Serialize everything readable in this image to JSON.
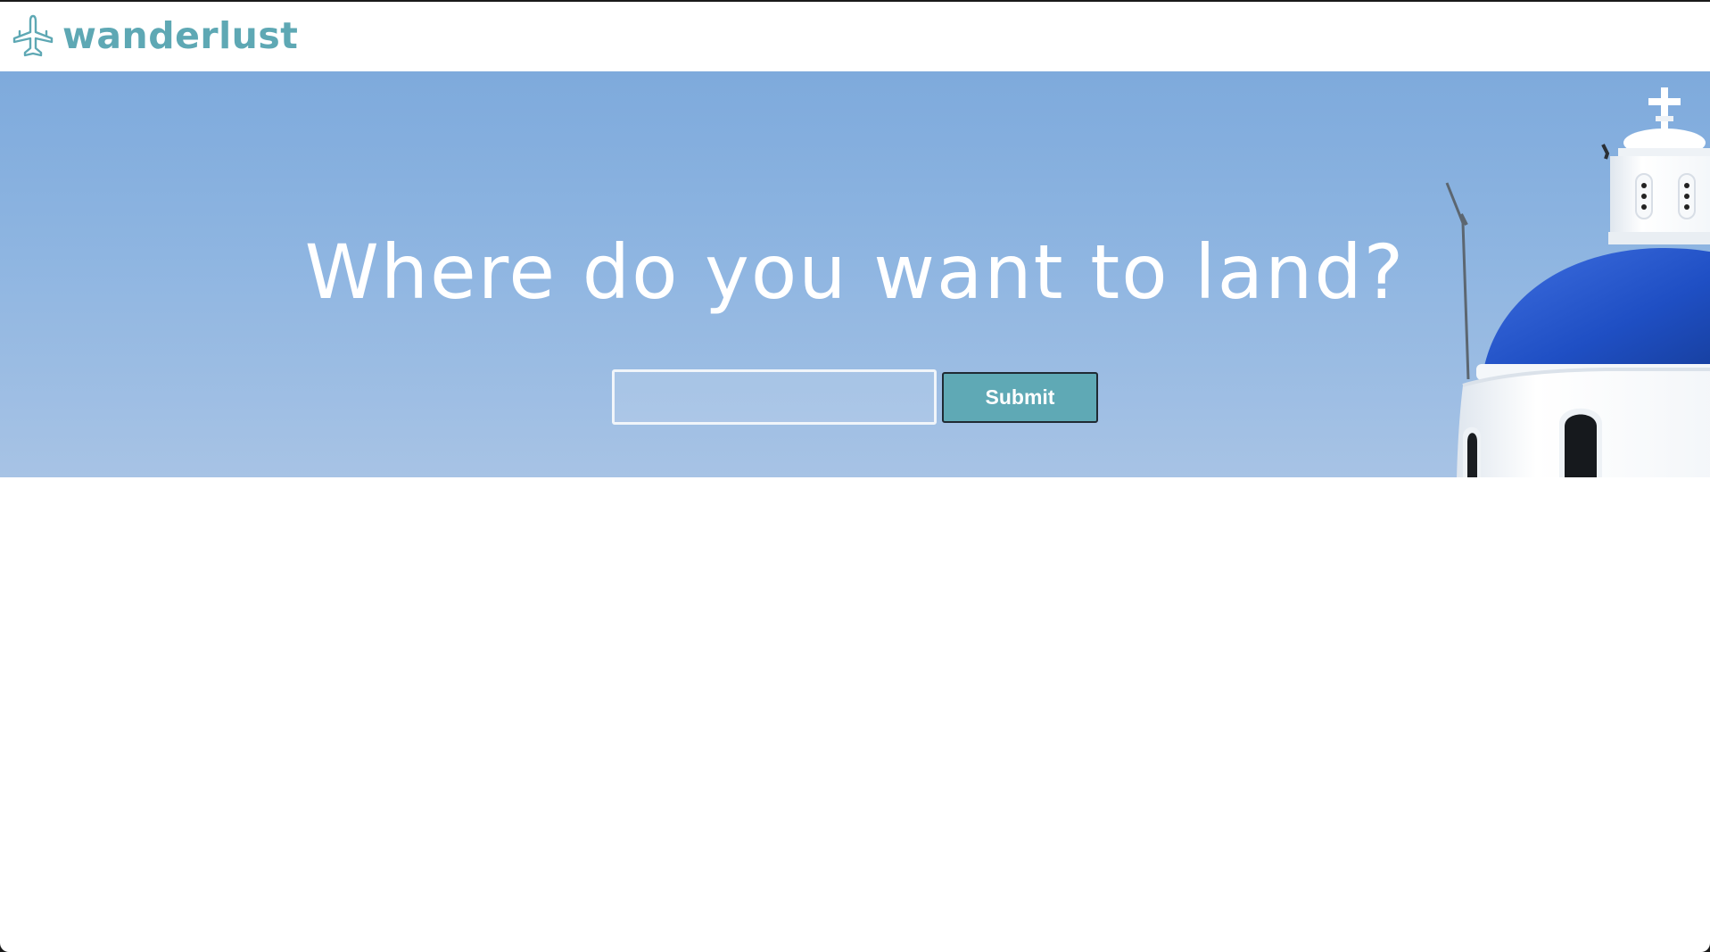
{
  "brand": {
    "name": "wanderlust",
    "icon": "airplane-icon",
    "color": "#5ea8b4"
  },
  "hero": {
    "headline": "Where do you want to land?",
    "background": "blue sky with white church and blue dome",
    "search": {
      "value": "",
      "placeholder": ""
    },
    "submit_label": "Submit",
    "button_color": "#5fa9b5"
  }
}
